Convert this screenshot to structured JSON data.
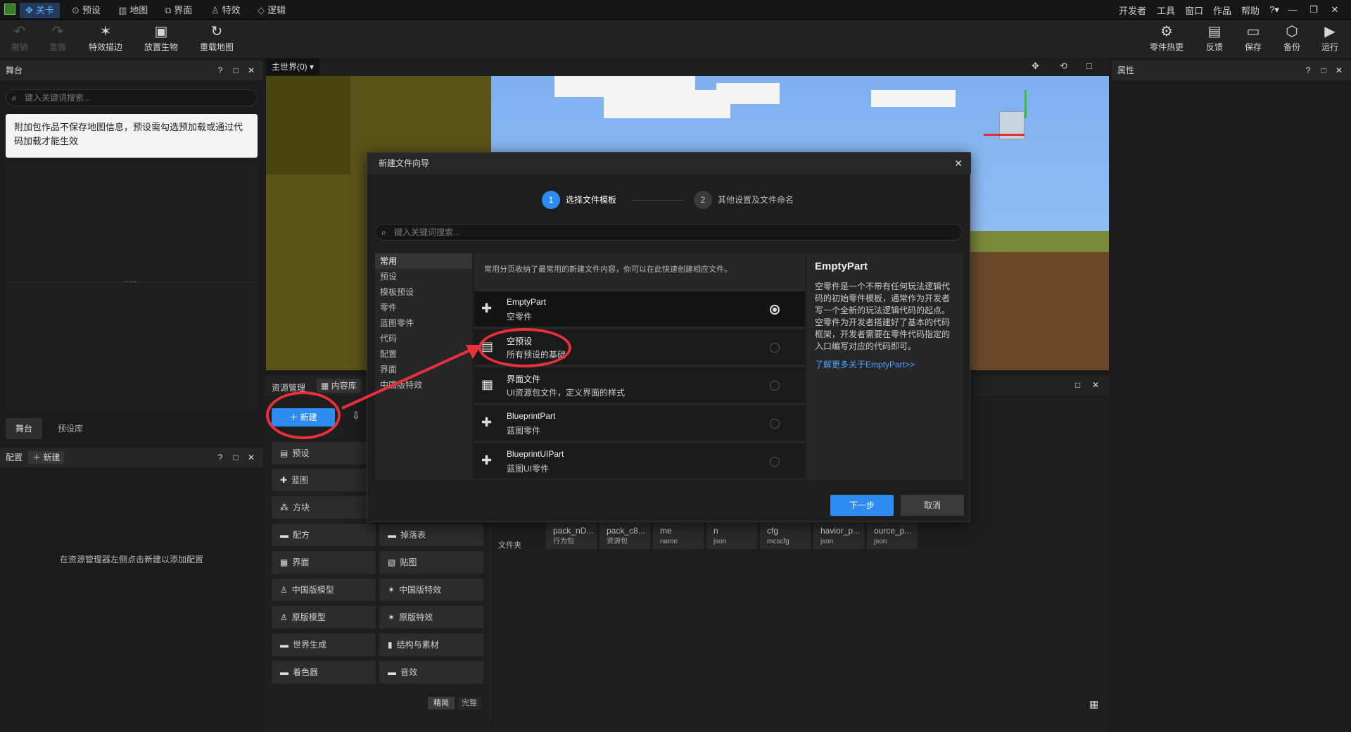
{
  "menubar": {
    "tabs": [
      {
        "label": "关卡",
        "icon": "level-icon"
      },
      {
        "label": "预设",
        "icon": "preset-icon"
      },
      {
        "label": "地图",
        "icon": "map-icon"
      },
      {
        "label": "界面",
        "icon": "ui-icon"
      },
      {
        "label": "特效",
        "icon": "effects-icon"
      },
      {
        "label": "逻辑",
        "icon": "logic-icon"
      }
    ],
    "right": [
      "开发者",
      "工具",
      "窗口",
      "作品",
      "帮助"
    ]
  },
  "toolbar": {
    "left": [
      {
        "label": "撤销",
        "icon": "undo-icon"
      },
      {
        "label": "重做",
        "icon": "redo-icon"
      },
      {
        "label": "特效描边",
        "icon": "effect-outline-icon"
      },
      {
        "label": "放置生物",
        "icon": "place-mob-icon"
      },
      {
        "label": "重载地图",
        "icon": "reload-map-icon"
      }
    ],
    "right": [
      {
        "label": "零件热更",
        "icon": "part-hot-update-icon"
      },
      {
        "label": "反馈",
        "icon": "feedback-icon"
      },
      {
        "label": "保存",
        "icon": "save-icon"
      },
      {
        "label": "备份",
        "icon": "backup-icon"
      },
      {
        "label": "运行",
        "icon": "run-icon"
      }
    ]
  },
  "stage": {
    "title": "舞台",
    "search_placeholder": "键入关键词搜索...",
    "notice": "附加包作品不保存地图信息，预设需勾选预加载或通过代码加载才能生效",
    "tabs": [
      "舞台",
      "预设库"
    ],
    "dots": "......"
  },
  "config": {
    "title": "配置",
    "new_label": "新建",
    "empty_hint": "在资源管理器左侧点击新建以添加配置"
  },
  "viewport": {
    "world_label": "主世界(0)"
  },
  "properties": {
    "title": "属性"
  },
  "resources": {
    "title": "资源管理",
    "content_lib": "内容库",
    "new_button": "新建",
    "left": [
      "预设",
      "蓝图",
      "方块",
      "配方",
      "界面",
      "中国版模型",
      "原版模型",
      "世界生成",
      "着色器"
    ],
    "right": [
      "掉落表",
      "贴图",
      "中国版特效",
      "原版特效",
      "结构与素材",
      "音效"
    ],
    "view_simple": "精简",
    "view_full": "完整",
    "files_label": "文件夹",
    "files": [
      {
        "name": "pack_nD...",
        "sub": "行为包"
      },
      {
        "name": "pack_c8...",
        "sub": "资源包"
      },
      {
        "name": "me",
        "sub": "name"
      },
      {
        "name": "n",
        "sub": "json"
      },
      {
        "name": "cfg",
        "sub": "mcscfg"
      },
      {
        "name": "havior_p...",
        "sub": "json"
      },
      {
        "name": "ource_p...",
        "sub": "json"
      }
    ]
  },
  "dialog": {
    "title": "新建文件向导",
    "step1_num": "1",
    "step1": "选择文件模板",
    "step2_num": "2",
    "step2": "其他设置及文件命名",
    "search_placeholder": "键入关键词搜索...",
    "categories": [
      "常用",
      "预设",
      "模板预设",
      "零件",
      "蓝图零件",
      "代码",
      "配置",
      "界面",
      "中国版特效"
    ],
    "intro": "常用分页收纳了最常用的新建文件内容，你可以在此快速创建相应文件。",
    "templates": [
      {
        "name": "EmptyPart",
        "desc": "空零件",
        "icon": "puzzle-icon",
        "selected": true
      },
      {
        "name": "空预设",
        "desc": "所有预设的基础",
        "icon": "preset-box-icon",
        "selected": false
      },
      {
        "name": "界面文件",
        "desc": "UI资源包文件，定义界面的样式",
        "icon": "ui-file-icon",
        "selected": false
      },
      {
        "name": "BlueprintPart",
        "desc": "蓝图零件",
        "icon": "puzzle-icon",
        "selected": false
      },
      {
        "name": "BlueprintUIPart",
        "desc": "蓝图UI零件",
        "icon": "puzzle-icon",
        "selected": false
      }
    ],
    "detail_title": "EmptyPart",
    "detail_desc": "空零件是一个不带有任何玩法逻辑代码的初始零件模板，通常作为开发者写一个全新的玩法逻辑代码的起点。空零件为开发者搭建好了基本的代码框架，开发者需要在零件代码指定的入口编写对应的代码即可。",
    "detail_link": "了解更多关于EmptyPart>>",
    "next": "下一步",
    "cancel": "取消"
  },
  "colors": {
    "accent": "#2d8cf0",
    "annotation": "#e8303a"
  }
}
